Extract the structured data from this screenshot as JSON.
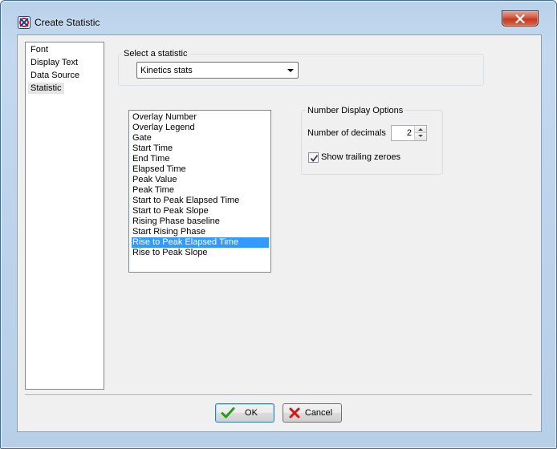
{
  "window": {
    "title": "Create Statistic"
  },
  "nav": {
    "items": [
      {
        "label": "Font"
      },
      {
        "label": "Display Text"
      },
      {
        "label": "Data Source"
      },
      {
        "label": "Statistic",
        "selected": true
      }
    ]
  },
  "select_group": {
    "label": "Select a statistic",
    "combo_value": "Kinetics stats"
  },
  "statistics_list": {
    "items": [
      "Overlay Number",
      "Overlay Legend",
      "Gate",
      "Start Time",
      "End Time",
      "Elapsed Time",
      "Peak Value",
      "Peak Time",
      "Start to Peak Elapsed Time",
      "Start to Peak Slope",
      "Rising Phase baseline",
      "Start Rising Phase",
      "Rise to Peak Elapsed Time",
      "Rise to Peak Slope"
    ],
    "selected_item": "Rise to Peak Elapsed Time"
  },
  "number_options": {
    "label": "Number Display Options",
    "decimals_label": "Number of decimals",
    "decimals_value": "2",
    "trailing_zeroes_label": "Show trailing zeroes",
    "trailing_zeroes_checked": true
  },
  "buttons": {
    "ok_label": "OK",
    "cancel_label": "Cancel"
  },
  "colors": {
    "selection": "#3399ff",
    "ok_check": "#2a9a1a",
    "cancel_x": "#d01818",
    "close_button": "#c13a22"
  }
}
